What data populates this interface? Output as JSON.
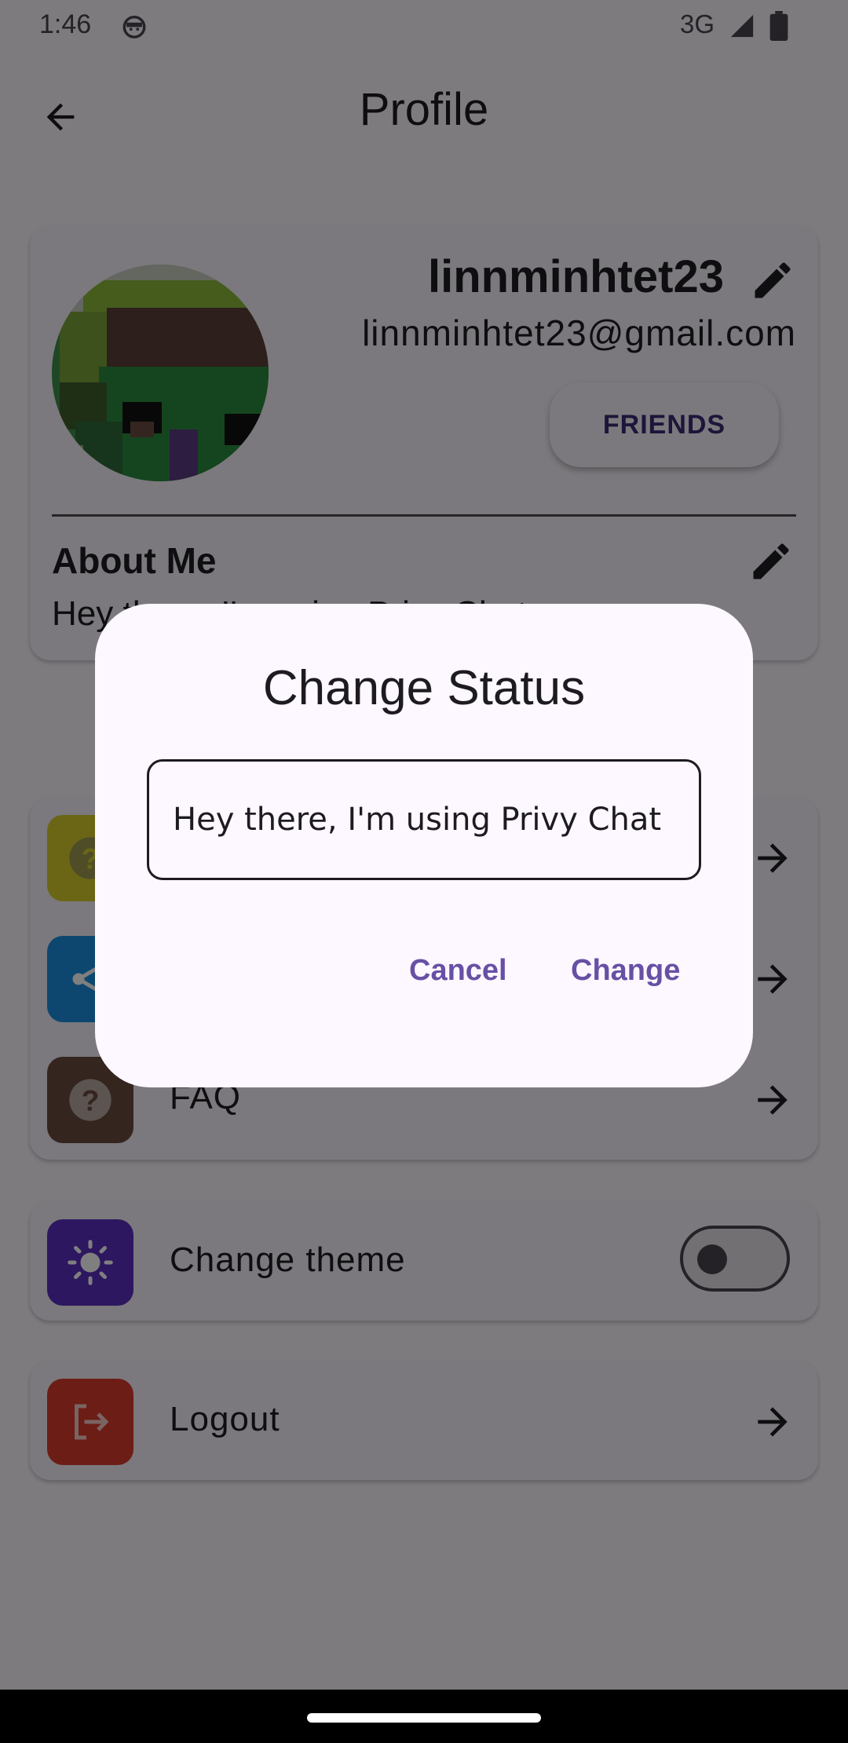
{
  "statusbar": {
    "time": "1:46",
    "network": "3G"
  },
  "appbar": {
    "title": "Profile"
  },
  "profile": {
    "username": "linnminhtet23",
    "email": "linnminhtet23@gmail.com",
    "friends_label": "FRIENDS",
    "about_label": "About Me",
    "about_text": "Hey there, I'm using Privy Chat"
  },
  "links": [
    {
      "label": "",
      "icon": "help-icon",
      "color": "#d6cc2a"
    },
    {
      "label": "",
      "icon": "share-icon",
      "color": "#1a8fe0"
    },
    {
      "label": "FAQ",
      "icon": "question-icon",
      "color": "#6b4a3e"
    }
  ],
  "theme": {
    "label": "Change theme",
    "icon": "sun-icon",
    "color": "#5b2fc0",
    "enabled": false
  },
  "logout": {
    "label": "Logout",
    "icon": "logout-icon",
    "color": "#d93a2b"
  },
  "dialog": {
    "title": "Change Status",
    "input_value": "Hey there, I'm using Privy Chat",
    "cancel_label": "Cancel",
    "change_label": "Change"
  },
  "colors": {
    "accent": "#6750a4",
    "friends_text": "#3d2a75"
  }
}
